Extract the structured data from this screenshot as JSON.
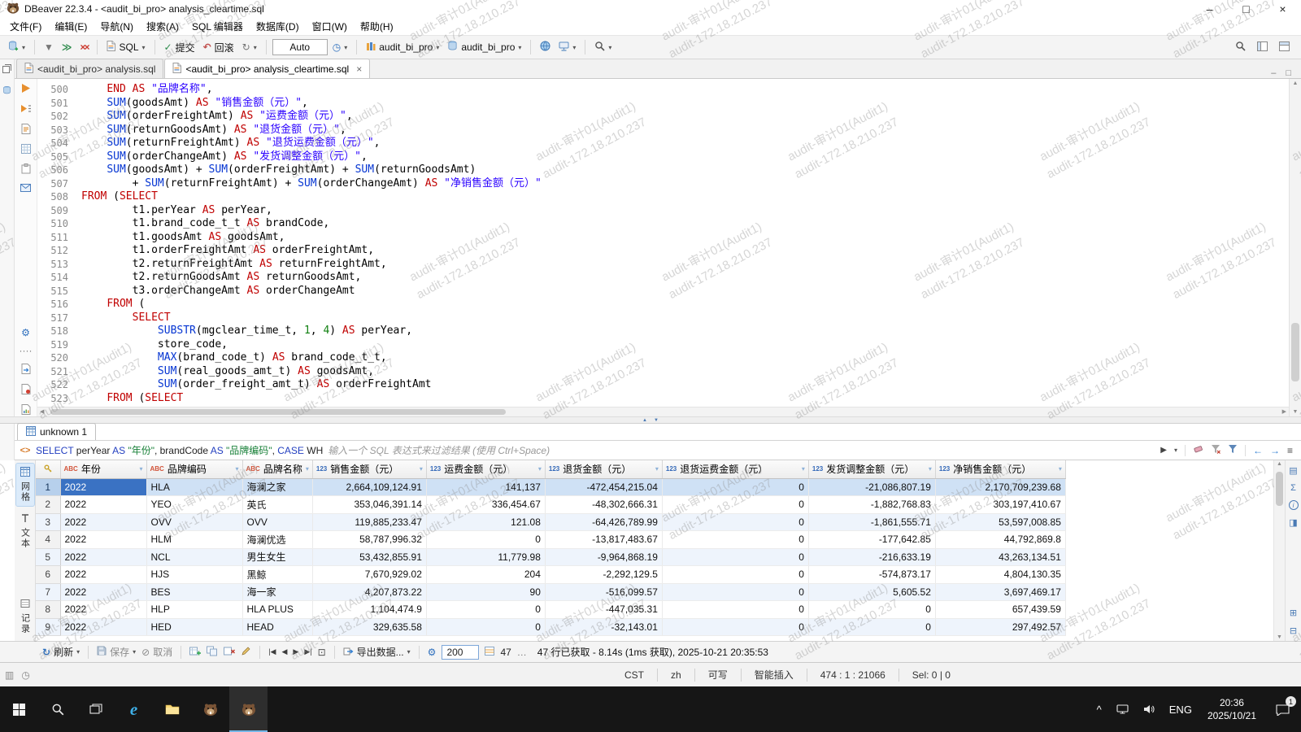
{
  "window": {
    "title": "DBeaver 22.3.4 - <audit_bi_pro> analysis_cleartime.sql"
  },
  "icons": {
    "dropdown": "▾",
    "minimize": "–",
    "maximize": "□",
    "close": "×",
    "play": "▶",
    "left": "◀",
    "right": "▶",
    "up": "▲",
    "down": "▼",
    "back": "←",
    "forward": "→",
    "refresh": "↻",
    "rollback": "↶",
    "commit": "✓",
    "gear": "⚙",
    "clock": "◷",
    "ellipsis": "…",
    "menu": "≡",
    "dots": "····",
    "caret": "^",
    "focus": "⊡",
    "cancel": "⊘",
    "splitter_up": "▲",
    "splitter_down": "▼"
  },
  "menu": {
    "items": [
      "文件(F)",
      "编辑(E)",
      "导航(N)",
      "搜索(A)",
      "SQL 编辑器",
      "数据库(D)",
      "窗口(W)",
      "帮助(H)"
    ]
  },
  "toolbar": {
    "sql_label": "SQL",
    "commit_label": "提交",
    "rollback_label": "回滚",
    "auto_label": "Auto",
    "connection": "audit_bi_pro",
    "schema": "audit_bi_pro"
  },
  "editor_tabs": [
    {
      "label": "<audit_bi_pro> analysis.sql",
      "active": false
    },
    {
      "label": "<audit_bi_pro> analysis_cleartime.sql",
      "active": true
    }
  ],
  "editor": {
    "lines": [
      {
        "n": 500,
        "t": [
          [
            "p",
            "    "
          ],
          [
            "k",
            "END AS"
          ],
          [
            "p",
            " "
          ],
          [
            "s",
            "\"品牌名称\""
          ],
          [
            "p",
            ","
          ]
        ]
      },
      {
        "n": 501,
        "t": [
          [
            "p",
            "    "
          ],
          [
            "f",
            "SUM"
          ],
          [
            "p",
            "(goodsAmt) "
          ],
          [
            "k",
            "AS"
          ],
          [
            "p",
            " "
          ],
          [
            "s",
            "\"销售金额（元）\""
          ],
          [
            "p",
            ","
          ]
        ]
      },
      {
        "n": 502,
        "t": [
          [
            "p",
            "    "
          ],
          [
            "f",
            "SUM"
          ],
          [
            "p",
            "(orderFreightAmt) "
          ],
          [
            "k",
            "AS"
          ],
          [
            "p",
            " "
          ],
          [
            "s",
            "\"运费金额（元）\""
          ],
          [
            "p",
            ","
          ]
        ]
      },
      {
        "n": 503,
        "t": [
          [
            "p",
            "    "
          ],
          [
            "f",
            "SUM"
          ],
          [
            "p",
            "(returnGoodsAmt) "
          ],
          [
            "k",
            "AS"
          ],
          [
            "p",
            " "
          ],
          [
            "s",
            "\"退货金额（元）\""
          ],
          [
            "p",
            ","
          ]
        ]
      },
      {
        "n": 504,
        "t": [
          [
            "p",
            "    "
          ],
          [
            "f",
            "SUM"
          ],
          [
            "p",
            "(returnFreightAmt) "
          ],
          [
            "k",
            "AS"
          ],
          [
            "p",
            " "
          ],
          [
            "s",
            "\"退货运费金额（元）\""
          ],
          [
            "p",
            ","
          ]
        ]
      },
      {
        "n": 505,
        "t": [
          [
            "p",
            "    "
          ],
          [
            "f",
            "SUM"
          ],
          [
            "p",
            "(orderChangeAmt) "
          ],
          [
            "k",
            "AS"
          ],
          [
            "p",
            " "
          ],
          [
            "s",
            "\"发货调整金额（元）\""
          ],
          [
            "p",
            ","
          ]
        ]
      },
      {
        "n": 506,
        "t": [
          [
            "p",
            "    "
          ],
          [
            "f",
            "SUM"
          ],
          [
            "p",
            "(goodsAmt) + "
          ],
          [
            "f",
            "SUM"
          ],
          [
            "p",
            "(orderFreightAmt) + "
          ],
          [
            "f",
            "SUM"
          ],
          [
            "p",
            "(returnGoodsAmt)"
          ]
        ]
      },
      {
        "n": 507,
        "t": [
          [
            "p",
            "        + "
          ],
          [
            "f",
            "SUM"
          ],
          [
            "p",
            "(returnFreightAmt) + "
          ],
          [
            "f",
            "SUM"
          ],
          [
            "p",
            "(orderChangeAmt) "
          ],
          [
            "k",
            "AS"
          ],
          [
            "p",
            " "
          ],
          [
            "s",
            "\"净销售金额（元）\""
          ]
        ]
      },
      {
        "n": 508,
        "t": [
          [
            "k",
            "FROM"
          ],
          [
            "p",
            " ("
          ],
          [
            "k",
            "SELECT"
          ]
        ]
      },
      {
        "n": 509,
        "t": [
          [
            "p",
            "        t1.perYear "
          ],
          [
            "k",
            "AS"
          ],
          [
            "p",
            " perYear,"
          ]
        ]
      },
      {
        "n": 510,
        "t": [
          [
            "p",
            "        t1.brand_code_t_t "
          ],
          [
            "k",
            "AS"
          ],
          [
            "p",
            " brandCode,"
          ]
        ]
      },
      {
        "n": 511,
        "t": [
          [
            "p",
            "        t1.goodsAmt "
          ],
          [
            "k",
            "AS"
          ],
          [
            "p",
            " goodsAmt,"
          ]
        ]
      },
      {
        "n": 512,
        "t": [
          [
            "p",
            "        t1.orderFreightAmt "
          ],
          [
            "k",
            "AS"
          ],
          [
            "p",
            " orderFreightAmt,"
          ]
        ]
      },
      {
        "n": 513,
        "t": [
          [
            "p",
            "        t2.returnFreightAmt "
          ],
          [
            "k",
            "AS"
          ],
          [
            "p",
            " returnFreightAmt,"
          ]
        ]
      },
      {
        "n": 514,
        "t": [
          [
            "p",
            "        t2.returnGoodsAmt "
          ],
          [
            "k",
            "AS"
          ],
          [
            "p",
            " returnGoodsAmt,"
          ]
        ]
      },
      {
        "n": 515,
        "t": [
          [
            "p",
            "        t3.orderChangeAmt "
          ],
          [
            "k",
            "AS"
          ],
          [
            "p",
            " orderChangeAmt"
          ]
        ]
      },
      {
        "n": 516,
        "t": [
          [
            "p",
            "    "
          ],
          [
            "k",
            "FROM"
          ],
          [
            "p",
            " ("
          ]
        ]
      },
      {
        "n": 517,
        "t": [
          [
            "p",
            "        "
          ],
          [
            "k",
            "SELECT"
          ]
        ]
      },
      {
        "n": 518,
        "t": [
          [
            "p",
            "            "
          ],
          [
            "f",
            "SUBSTR"
          ],
          [
            "p",
            "(mgclear_time_t, "
          ],
          [
            "n",
            "1"
          ],
          [
            "p",
            ", "
          ],
          [
            "n",
            "4"
          ],
          [
            "p",
            ") "
          ],
          [
            "k",
            "AS"
          ],
          [
            "p",
            " perYear,"
          ]
        ]
      },
      {
        "n": 519,
        "t": [
          [
            "p",
            "            store_code,"
          ]
        ]
      },
      {
        "n": 520,
        "t": [
          [
            "p",
            "            "
          ],
          [
            "f",
            "MAX"
          ],
          [
            "p",
            "(brand_code_t) "
          ],
          [
            "k",
            "AS"
          ],
          [
            "p",
            " brand_code_t_t,"
          ]
        ]
      },
      {
        "n": 521,
        "t": [
          [
            "p",
            "            "
          ],
          [
            "f",
            "SUM"
          ],
          [
            "p",
            "(real_goods_amt_t) "
          ],
          [
            "k",
            "AS"
          ],
          [
            "p",
            " goodsAmt,"
          ]
        ]
      },
      {
        "n": 522,
        "t": [
          [
            "p",
            "            "
          ],
          [
            "f",
            "SUM"
          ],
          [
            "p",
            "(order_freight_amt_t) "
          ],
          [
            "k",
            "AS"
          ],
          [
            "p",
            " orderFreightAmt"
          ]
        ]
      },
      {
        "n": 523,
        "t": [
          [
            "p",
            "    "
          ],
          [
            "k",
            "FROM"
          ],
          [
            "p",
            " ("
          ],
          [
            "k",
            "SELECT"
          ]
        ]
      }
    ]
  },
  "watermark": {
    "line1": "audit-审计01(Audit1)",
    "line2": "audit-172.18.210.237"
  },
  "results": {
    "tab_label": "unknown 1",
    "filter_tokens": [
      [
        "k",
        "SELECT"
      ],
      [
        "p",
        " perYear "
      ],
      [
        "k",
        "AS"
      ],
      [
        "p",
        " "
      ],
      [
        "s",
        "\"年份\""
      ],
      [
        "p",
        ", brandCode "
      ],
      [
        "k",
        "AS"
      ],
      [
        "p",
        " "
      ],
      [
        "s",
        "\"品牌编码\""
      ],
      [
        "p",
        ", "
      ],
      [
        "k",
        "CASE"
      ],
      [
        "p",
        " WH"
      ]
    ],
    "filter_placeholder": "输入一个 SQL 表达式来过滤结果 (使用 Ctrl+Space)",
    "side_tabs": [
      {
        "label": "网格",
        "active": true
      },
      {
        "label": "文本",
        "active": false
      },
      {
        "label": "记录",
        "active": false,
        "bottom": true
      }
    ],
    "columns": [
      {
        "type": "ABC",
        "label": "年份"
      },
      {
        "type": "ABC",
        "label": "品牌编码"
      },
      {
        "type": "ABC",
        "label": "品牌名称"
      },
      {
        "type": "123",
        "label": "销售金额（元）"
      },
      {
        "type": "123",
        "label": "运费金额（元）"
      },
      {
        "type": "123",
        "label": "退货金额（元）"
      },
      {
        "type": "123",
        "label": "退货运费金额（元）"
      },
      {
        "type": "123",
        "label": "发货调整金额（元）"
      },
      {
        "type": "123",
        "label": "净销售金额（元）"
      }
    ],
    "rows": [
      [
        "2022",
        "HLA",
        "海澜之家",
        "2,664,109,124.91",
        "141,137",
        "-472,454,215.04",
        "0",
        "-21,086,807.19",
        "2,170,709,239.68"
      ],
      [
        "2022",
        "YEO",
        "英氏",
        "353,046,391.14",
        "336,454.67",
        "-48,302,666.31",
        "0",
        "-1,882,768.83",
        "303,197,410.67"
      ],
      [
        "2022",
        "OVV",
        "OVV",
        "119,885,233.47",
        "121.08",
        "-64,426,789.99",
        "0",
        "-1,861,555.71",
        "53,597,008.85"
      ],
      [
        "2022",
        "HLM",
        "海澜优选",
        "58,787,996.32",
        "0",
        "-13,817,483.67",
        "0",
        "-177,642.85",
        "44,792,869.8"
      ],
      [
        "2022",
        "NCL",
        "男生女生",
        "53,432,855.91",
        "11,779.98",
        "-9,964,868.19",
        "0",
        "-216,633.19",
        "43,263,134.51"
      ],
      [
        "2022",
        "HJS",
        "黑鲸",
        "7,670,929.02",
        "204",
        "-2,292,129.5",
        "0",
        "-574,873.17",
        "4,804,130.35"
      ],
      [
        "2022",
        "BES",
        "海一家",
        "4,207,873.22",
        "90",
        "-516,099.57",
        "0",
        "5,605.52",
        "3,697,469.17"
      ],
      [
        "2022",
        "HLP",
        "HLA PLUS",
        "1,104,474.9",
        "0",
        "-447,035.31",
        "0",
        "0",
        "657,439.59"
      ],
      [
        "2022",
        "HED",
        "HEAD",
        "329,635.58",
        "0",
        "-32,143.01",
        "0",
        "0",
        "297,492.57"
      ]
    ],
    "selection": {
      "row": 1,
      "column": "年份"
    },
    "toolbar": {
      "refresh_label": "刷新",
      "save_label": "保存",
      "cancel_label": "取消",
      "export_label": "导出数据...",
      "fetch_size": "200",
      "row_count": "47",
      "status": "47 行已获取 - 8.14s (1ms 获取), 2025-10-21 20:35:53"
    }
  },
  "statusbar": {
    "items": [
      "CST",
      "zh",
      "可写",
      "智能插入",
      "474 : 1 : 21066",
      "Sel: 0 | 0"
    ]
  },
  "taskbar": {
    "lang": "ENG",
    "time": "20:36",
    "date": "2025/10/21",
    "badge": "1"
  }
}
